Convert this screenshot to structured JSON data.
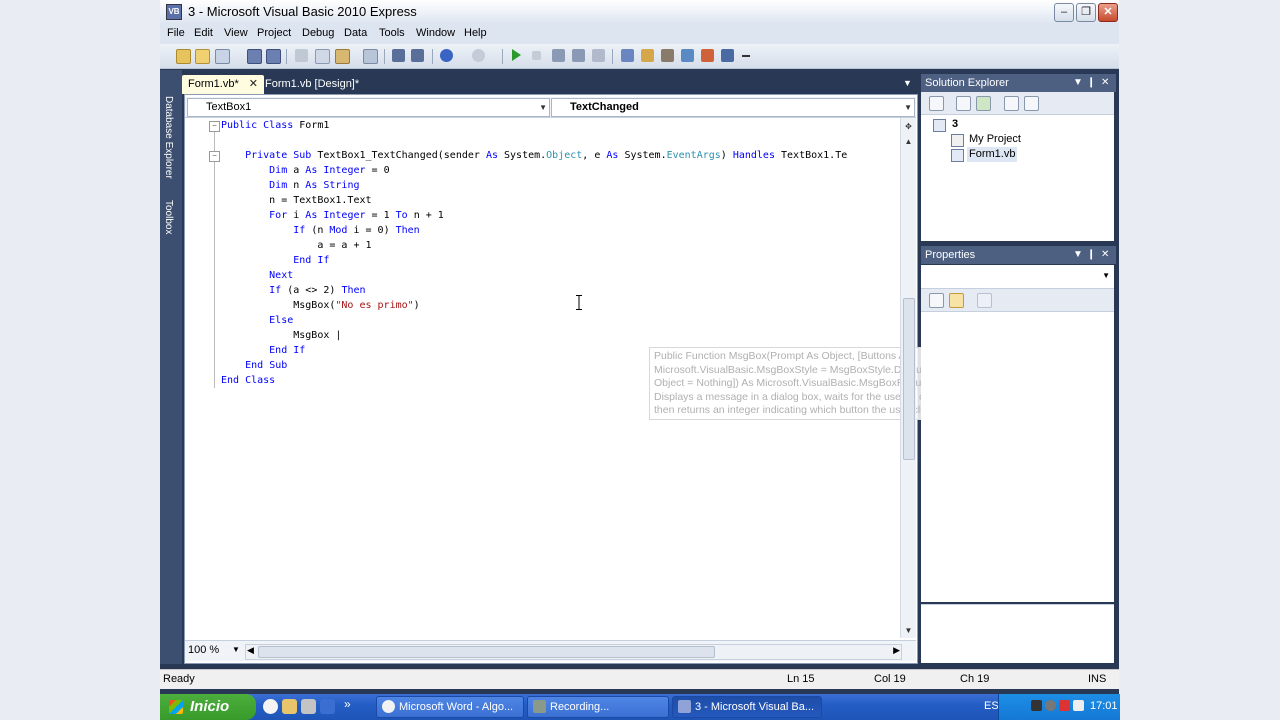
{
  "window": {
    "title": "3 - Microsoft Visual Basic 2010 Express",
    "icon_label": "VB",
    "controls": {
      "minimize": "–",
      "maximize": "❐",
      "close": "✕"
    }
  },
  "menu": [
    "File",
    "Edit",
    "View",
    "Project",
    "Debug",
    "Data",
    "Tools",
    "Window",
    "Help"
  ],
  "left_strip": {
    "database_explorer": "Database Explorer",
    "toolbox": "Toolbox"
  },
  "tabs": [
    {
      "label": "Form1.vb*",
      "close": "✕"
    },
    {
      "label": "Form1.vb [Design]*"
    }
  ],
  "tab_dropdown": "▼",
  "editor": {
    "object_combo": "TextBox1",
    "event_combo": "TextChanged",
    "zoom": "100 %",
    "code": {
      "l1_a": "Public",
      "l1_b": " ",
      "l1_c": "Class",
      "l1_d": " Form1",
      "l3_a": "    Private",
      "l3_b": " ",
      "l3_c": "Sub",
      "l3_d": " TextBox1_TextChanged(sender ",
      "l3_e": "As",
      "l3_f": " System.",
      "l3_g": "Object",
      "l3_h": ", e ",
      "l3_i": "As",
      "l3_j": " System.",
      "l3_k": "EventArgs",
      "l3_l": ") ",
      "l3_m": "Handles",
      "l3_n": " TextBox1.Te",
      "l4_a": "        Dim",
      "l4_b": " a ",
      "l4_c": "As",
      "l4_d": " ",
      "l4_e": "Integer",
      "l4_f": " = 0",
      "l5_a": "        Dim",
      "l5_b": " n ",
      "l5_c": "As",
      "l5_d": " ",
      "l5_e": "String",
      "l6": "        n = TextBox1.Text",
      "l7_a": "        For",
      "l7_b": " i ",
      "l7_c": "As",
      "l7_d": " ",
      "l7_e": "Integer",
      "l7_f": " = 1 ",
      "l7_g": "To",
      "l7_h": " n + 1",
      "l8_a": "            If",
      "l8_b": " (n ",
      "l8_c": "Mod",
      "l8_d": " i = 0) ",
      "l8_e": "Then",
      "l9": "                a = a + 1",
      "l10_a": "            End",
      "l10_b": " ",
      "l10_c": "If",
      "l11": "        Next",
      "l12_a": "        If",
      "l12_b": " (a <> 2) ",
      "l12_c": "Then",
      "l13_a": "            MsgBox(",
      "l13_b": "\"No es primo\"",
      "l13_c": ")",
      "l14": "        Else",
      "l15": "            MsgBox |",
      "l16_a": "        End",
      "l16_b": " ",
      "l16_c": "If",
      "l17_a": "    End",
      "l17_b": " ",
      "l17_c": "Sub",
      "l18_a": "End",
      "l18_b": " ",
      "l18_c": "Class"
    },
    "tooltip": {
      "line1": "Public Function MsgBox(Prompt As Object, [Buttons As",
      "line2": "Microsoft.VisualBasic.MsgBoxStyle = MsgBoxStyle.DefaultButton1], [Title As",
      "line3": "Object = Nothing]) As Microsoft.VisualBasic.MsgBoxResult",
      "line4": "Displays a message in a dialog box, waits for the user to click a button, and",
      "line5": "then returns an integer indicating which button the user clicked."
    }
  },
  "solution_explorer": {
    "title": "Solution Explorer",
    "items": [
      "3",
      "My Project",
      "Form1.vb"
    ]
  },
  "properties": {
    "title": "Properties"
  },
  "panel_controls": {
    "dropdown": "▼",
    "pin": "❙",
    "close": "✕"
  },
  "status": {
    "ready": "Ready",
    "ln": "Ln 15",
    "col": "Col 19",
    "ch": "Ch 19",
    "ins": "INS"
  },
  "taskbar": {
    "start": "Inicio",
    "more": "»",
    "tasks": [
      "Microsoft Word - Algo...",
      "Recording...",
      "3 - Microsoft Visual Ba..."
    ],
    "lang": "ES",
    "clock": "17:01"
  },
  "colors": {
    "keyword": "#0000ff",
    "type": "#2b91af",
    "string": "#a31515",
    "ide_frame": "#293955"
  }
}
